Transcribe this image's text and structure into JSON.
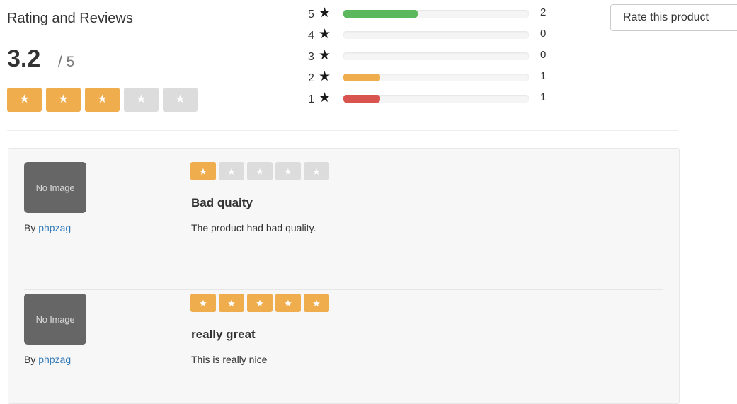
{
  "summary": {
    "title": "Rating and Reviews",
    "average": "3.2",
    "max": "/ 5",
    "average_stars_filled": 3,
    "stars_total": 5
  },
  "breakdown": [
    {
      "label": "5",
      "count": "2",
      "fill_fraction": 0.4,
      "color": "#5cb85c"
    },
    {
      "label": "4",
      "count": "0",
      "fill_fraction": 0,
      "color": "#5cb85c"
    },
    {
      "label": "3",
      "count": "0",
      "fill_fraction": 0,
      "color": "#5bc0de"
    },
    {
      "label": "2",
      "count": "1",
      "fill_fraction": 0.2,
      "color": "#f0ad4e"
    },
    {
      "label": "1",
      "count": "1",
      "fill_fraction": 0.2,
      "color": "#d9534f"
    }
  ],
  "rate_button": {
    "label": "Rate this product"
  },
  "reviews": [
    {
      "avatar_text": "No Image",
      "by_label": "By",
      "author": "phpzag",
      "stars_filled": 1,
      "title": "Bad quaity",
      "text": "The product had bad quality."
    },
    {
      "avatar_text": "No Image",
      "by_label": "By",
      "author": "phpzag",
      "stars_filled": 5,
      "title": "really great",
      "text": "This is really nice"
    }
  ],
  "colors": {
    "star_on": "#f0ad4e",
    "star_off": "#dcdcdc",
    "link": "#337ab7"
  },
  "icons": {
    "star": "star-icon"
  }
}
